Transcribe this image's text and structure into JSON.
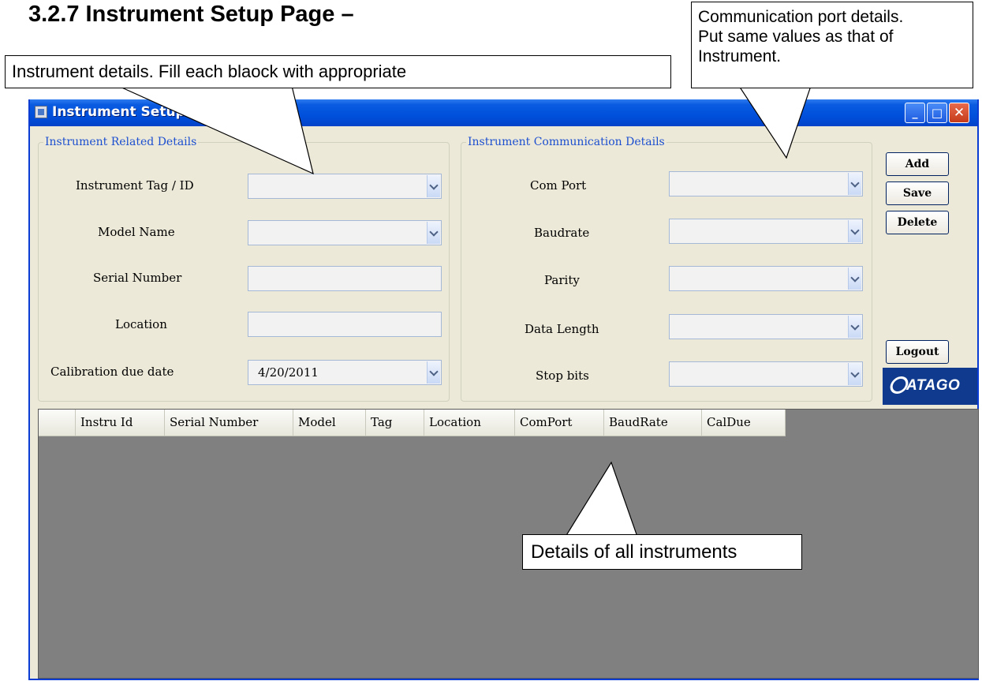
{
  "document": {
    "heading": "3.2.7 Instrument Setup Page –"
  },
  "window": {
    "title": "Instrument Setup",
    "controls": {
      "minimize": "_",
      "maximize": "□",
      "close": "✕"
    }
  },
  "related_details": {
    "legend": "Instrument Related Details",
    "fields": {
      "tag_label": "Instrument Tag / ID",
      "model_label": "Model Name",
      "serial_label": "Serial Number",
      "location_label": "Location",
      "caldue_label": "Calibration due date",
      "caldue_value": "4/20/2011"
    }
  },
  "communication_details": {
    "legend": "Instrument Communication Details",
    "fields": {
      "comport_label": "Com Port",
      "baudrate_label": "Baudrate",
      "parity_label": "Parity",
      "datalength_label": "Data Length",
      "stopbits_label": "Stop bits"
    }
  },
  "buttons": {
    "add": "Add",
    "save": "Save",
    "delete": "Delete",
    "logout": "Logout"
  },
  "logo": {
    "text": "ATAGO"
  },
  "grid": {
    "columns": [
      "Instru Id",
      "Serial Number",
      "Model",
      "Tag",
      "Location",
      "ComPort",
      "BaudRate",
      "CalDue"
    ],
    "rows": []
  },
  "callouts": {
    "instrument_details": "Instrument details. Fill each blaock with appropriate",
    "comm_details_line1": "Communication port details.",
    "comm_details_line2": "Put same values as that of",
    "comm_details_line3": "Instrument.",
    "grid_details": "Details of all instruments"
  }
}
